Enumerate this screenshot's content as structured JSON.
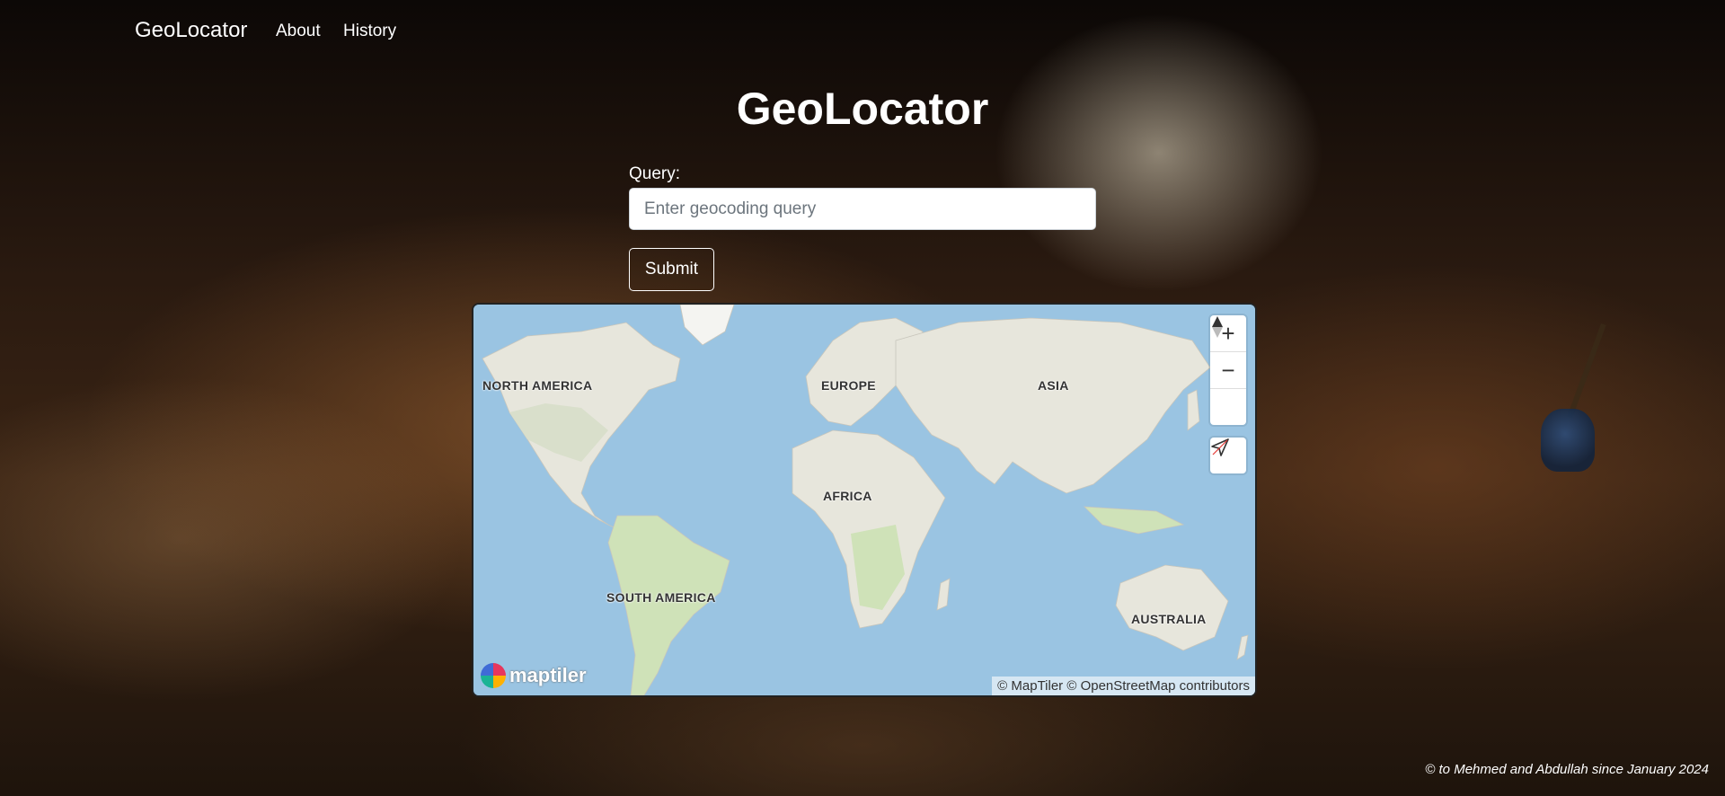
{
  "nav": {
    "brand": "GeoLocator",
    "links": [
      {
        "label": "About"
      },
      {
        "label": "History"
      }
    ]
  },
  "main": {
    "title": "GeoLocator",
    "query_label": "Query:",
    "query_placeholder": "Enter geocoding query",
    "query_value": "",
    "submit_label": "Submit"
  },
  "map": {
    "continent_labels": [
      "NORTH AMERICA",
      "EUROPE",
      "ASIA",
      "AFRICA",
      "SOUTH AMERICA",
      "AUSTRALIA"
    ],
    "controls": {
      "zoom_in": "+",
      "zoom_out": "−",
      "compass_icon": "compass-icon",
      "geolocate_icon": "geolocate-icon"
    },
    "logo_text": "maptiler",
    "attribution": "© MapTiler © OpenStreetMap contributors",
    "colors": {
      "water": "#9ac4e2",
      "land": "#e7e6dc",
      "vegetation": "#cfe2b8"
    }
  },
  "footer": {
    "text": "© to Mehmed and Abdullah since January 2024"
  }
}
